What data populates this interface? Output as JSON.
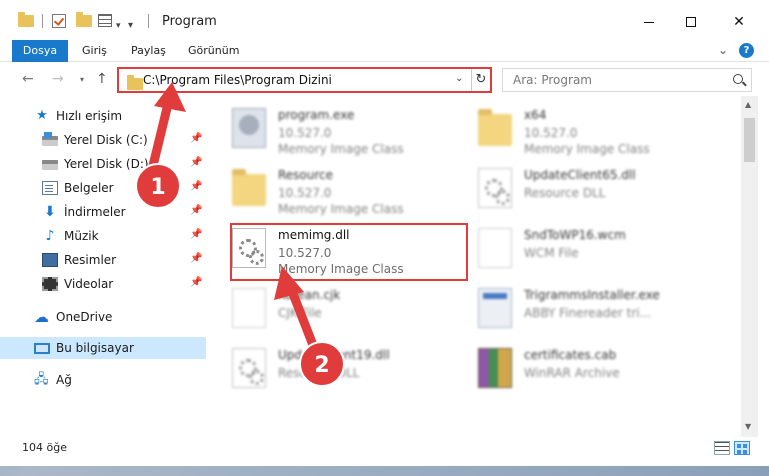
{
  "window": {
    "title": "Program"
  },
  "ribbon": {
    "file_tab": "Dosya",
    "tabs": [
      "Giriş",
      "Paylaş",
      "Görünüm"
    ],
    "help": "?"
  },
  "address": {
    "path": "C:\\Program Files\\Program Dizini"
  },
  "search": {
    "placeholder": "Ara: Program"
  },
  "sidebar": {
    "quick_access": "Hızlı erişim",
    "items": [
      {
        "label": "Yerel Disk (C:)",
        "icon": "disk-c-icon"
      },
      {
        "label": "Yerel Disk (D:)",
        "icon": "disk-d-icon"
      },
      {
        "label": "Belgeler",
        "icon": "documents-icon"
      },
      {
        "label": "İndirmeler",
        "icon": "downloads-icon"
      },
      {
        "label": "Müzik",
        "icon": "music-icon"
      },
      {
        "label": "Resimler",
        "icon": "pictures-icon"
      },
      {
        "label": "Videolar",
        "icon": "videos-icon"
      }
    ],
    "onedrive": "OneDrive",
    "this_pc": "Bu bilgisayar",
    "network": "Ağ"
  },
  "files": [
    {
      "name": "program.exe",
      "version": "10.527.0",
      "desc": "Memory Image Class",
      "icon": "program-icon"
    },
    {
      "name": "x64",
      "version": "10.527.0",
      "desc": "Memory Image Class",
      "icon": "folder-icon"
    },
    {
      "name": "Resource",
      "version": "10.527.0",
      "desc": "Memory Image Class",
      "icon": "folder-icon"
    },
    {
      "name": "UpdateClient65.dll",
      "version": "Resource DLL",
      "desc": "",
      "icon": "dll-icon"
    },
    {
      "name": "memimg.dll",
      "version": "10.527.0",
      "desc": "Memory Image Class",
      "icon": "dll-icon"
    },
    {
      "name": "SndToWP16.wcm",
      "version": "WCM File",
      "desc": "",
      "icon": "wcm-icon"
    },
    {
      "name": "Korean.cjk",
      "version": "CJK File",
      "desc": "",
      "icon": "blank-icon"
    },
    {
      "name": "TrigrammsInstaller.exe",
      "version": "ABBY Finereader tri...",
      "desc": "",
      "icon": "exe-icon"
    },
    {
      "name": "UpdateClient19.dll",
      "version": "Resource DLL",
      "desc": "",
      "icon": "dll-icon"
    },
    {
      "name": "certificates.cab",
      "version": "WinRAR Archive",
      "desc": "",
      "icon": "cab-icon"
    }
  ],
  "status": {
    "count": "104 öğe"
  },
  "annotations": {
    "step1": "1",
    "step2": "2",
    "accent": "#e03c3c"
  }
}
